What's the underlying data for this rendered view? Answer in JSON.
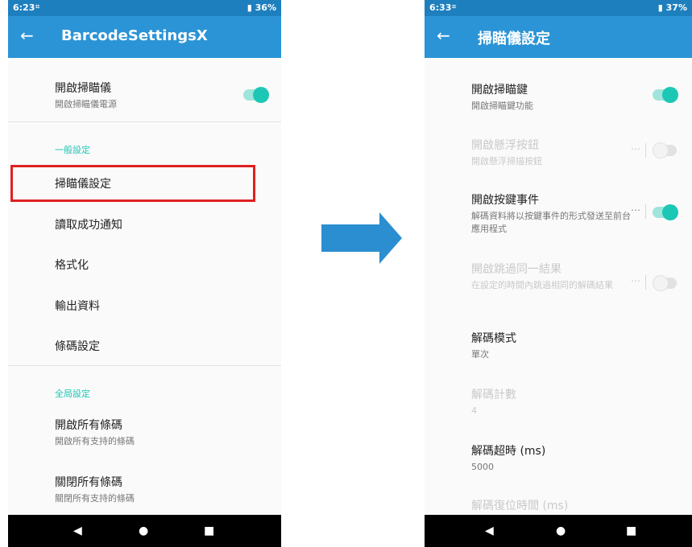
{
  "left": {
    "status": {
      "time": "6:23",
      "battery": "36%"
    },
    "app_title": "BarcodeSettingsX",
    "scanner": {
      "title": "開啟掃瞄儀",
      "subtitle": "開啟掃瞄儀電源",
      "enabled": true
    },
    "general_header": "一般設定",
    "general_items": [
      "掃瞄儀設定",
      "讀取成功通知",
      "格式化",
      "輸出資料",
      "條碼設定"
    ],
    "global_header": "全局設定",
    "global_items": [
      {
        "title": "開啟所有條碼",
        "subtitle": "開啟所有支持的條碼"
      },
      {
        "title": "關閉所有條碼",
        "subtitle": "關閉所有支持的條碼"
      }
    ]
  },
  "right": {
    "status": {
      "time": "6:33",
      "battery": "37%"
    },
    "app_title": "掃瞄儀設定",
    "items": [
      {
        "title": "開啟掃瞄鍵",
        "subtitle": "開啟掃瞄鍵功能",
        "toggle": true,
        "enabled": true
      },
      {
        "title": "開啟懸浮按鈕",
        "subtitle": "開啟懸浮掃描按鈕",
        "toggle": false,
        "enabled": false
      },
      {
        "title": "開啟按鍵事件",
        "subtitle": "解碼資料將以按鍵事件的形式發送至前台應用程式",
        "toggle": true,
        "enabled": true
      },
      {
        "title": "開啟跳過同一結果",
        "subtitle": "在設定的時間內跳過相同的解碼結果",
        "toggle": false,
        "enabled": false
      },
      {
        "title": "解碼模式",
        "subtitle": "單次",
        "enabled": true
      },
      {
        "title": "解碼計數",
        "subtitle": "4",
        "enabled": false
      },
      {
        "title": "解碼超時 (ms)",
        "subtitle": "5000",
        "enabled": true
      },
      {
        "title": "解碼復位時間 (ms)",
        "enabled": false
      }
    ],
    "more_icon": "⋯"
  },
  "colors": {
    "accent": "#1dc7b5",
    "appbar": "#2b94d6",
    "statusbar": "#1e7fbe",
    "highlight": "#e02020",
    "arrow": "#2b8ed0"
  }
}
